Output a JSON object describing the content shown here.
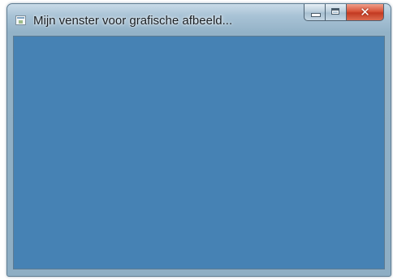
{
  "window": {
    "title": "Mijn venster voor grafische afbeeld...",
    "icon": "application-window-icon",
    "client_color": "#4682b4",
    "caption_buttons": {
      "minimize_icon": "minimize-icon",
      "maximize_icon": "maximize-icon",
      "close_glyph": "✕"
    }
  }
}
